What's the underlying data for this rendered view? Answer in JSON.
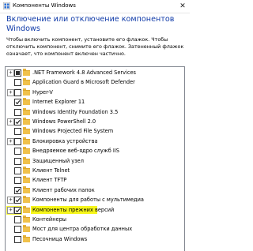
{
  "window": {
    "title": "Компоненты Windows",
    "close_glyph": "✕"
  },
  "heading": "Включение или отключение компонентов Windows",
  "description": "Чтобы включить компонент, установите его флажок. Чтобы отключить компонент, снимите его флажок. Затененный флажок означает, что компонент включен частично.",
  "features": [
    {
      "label": ".NET Framework 4.8 Advanced Services",
      "state": "partial",
      "expandable": true
    },
    {
      "label": "Application Guard в Microsoft Defender",
      "state": "unchecked",
      "expandable": false
    },
    {
      "label": "Hyper-V",
      "state": "unchecked",
      "expandable": true
    },
    {
      "label": "Internet Explorer 11",
      "state": "checked",
      "expandable": false
    },
    {
      "label": "Windows Identity Foundation 3.5",
      "state": "unchecked",
      "expandable": false
    },
    {
      "label": "Windows PowerShell 2.0",
      "state": "checked",
      "expandable": true
    },
    {
      "label": "Windows Projected File System",
      "state": "unchecked",
      "expandable": false
    },
    {
      "label": "Блокировка устройства",
      "state": "unchecked",
      "expandable": true
    },
    {
      "label": "Внедряемое веб-ядро служб IIS",
      "state": "unchecked",
      "expandable": false
    },
    {
      "label": "Защищенный узел",
      "state": "unchecked",
      "expandable": false
    },
    {
      "label": "Клиент Telnet",
      "state": "unchecked",
      "expandable": false
    },
    {
      "label": "Клиент TFTP",
      "state": "unchecked",
      "expandable": false
    },
    {
      "label": "Клиент рабочих папок",
      "state": "checked",
      "expandable": false
    },
    {
      "label": "Компоненты для работы с мультимедиа",
      "state": "checked",
      "expandable": true
    },
    {
      "label": "Компоненты прежних версий",
      "state": "checked",
      "expandable": true,
      "highlighted": true
    },
    {
      "label": "Контейнеры",
      "state": "unchecked",
      "expandable": false
    },
    {
      "label": "Мост для центра обработки данных",
      "state": "unchecked",
      "expandable": false
    },
    {
      "label": "Песочница Windows",
      "state": "unchecked",
      "expandable": false
    }
  ],
  "colors": {
    "heading": "#0f3aa8",
    "highlight": "#f6f61a",
    "folder": "#f0c14b"
  }
}
